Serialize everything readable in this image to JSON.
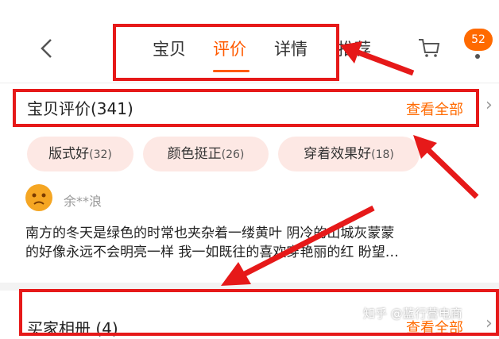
{
  "header": {
    "back_icon": "chevron-left-icon",
    "tabs": [
      {
        "label": "宝贝"
      },
      {
        "label": "评价"
      },
      {
        "label": "详情"
      }
    ],
    "extra_tab": "推荐",
    "cart_icon": "cart-icon",
    "badge_count": "52",
    "more_icon": "more-dot-icon"
  },
  "reviews": {
    "title": "宝贝评价(341)",
    "view_all": "查看全部",
    "tags": [
      {
        "label": "版式好",
        "count": "(32)"
      },
      {
        "label": "颜色挺正",
        "count": "(26)"
      },
      {
        "label": "穿着效果好",
        "count": "(18)"
      }
    ],
    "reviewer": "余**浪",
    "text_line1": "南方的冬天是绿色的时常也夹杂着一缕黄叶 阴冷的山城灰蒙蒙",
    "text_line2": "的好像永远不会明亮一样 我一如既往的喜欢穿艳丽的红 盼望…"
  },
  "album": {
    "title": "买家相册 (4)",
    "view_all": "查看全部"
  },
  "watermark": "知乎 @蓝行营电商",
  "colors": {
    "accent": "#ff5a00",
    "highlight": "#e61919",
    "tag_bg": "#fde8e4"
  }
}
